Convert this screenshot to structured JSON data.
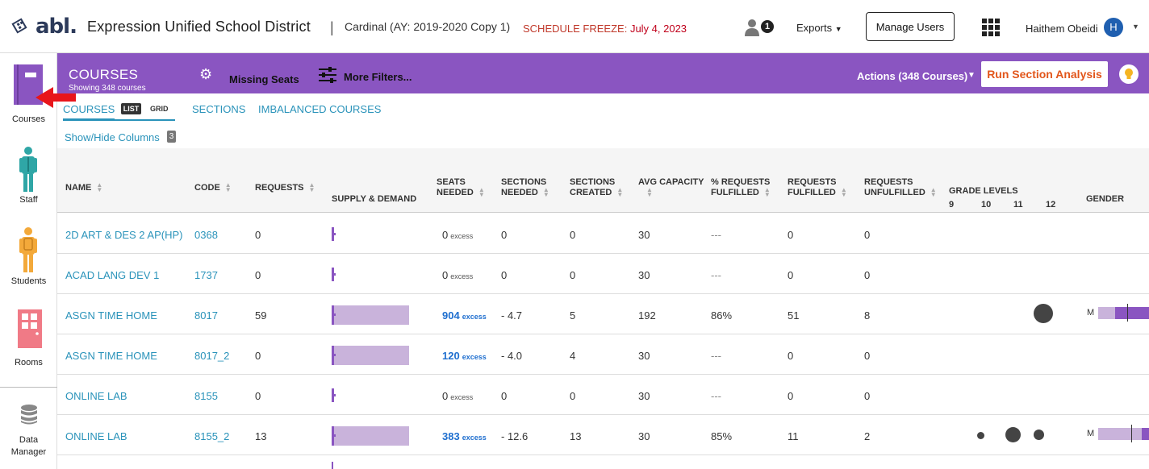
{
  "app": {
    "logo_text": "abl.",
    "district": "Expression Unified School District",
    "separator": "|",
    "schedule": "Cardinal (AY: 2019-2020 Copy 1)",
    "freeze_label": "SCHEDULE FREEZE:",
    "freeze_date": "July 4, 2023",
    "notif_count": "1",
    "exports_label": "Exports",
    "manage_users_label": "Manage Users",
    "user_name": "Haithem Obeidi",
    "user_initial": "H"
  },
  "sidebar": {
    "items": [
      {
        "label": "Courses"
      },
      {
        "label": "Staff"
      },
      {
        "label": "Students"
      },
      {
        "label": "Rooms"
      },
      {
        "label": "Data"
      },
      {
        "label": "Manager"
      }
    ]
  },
  "header": {
    "title": "COURSES",
    "showing": "Showing 348 courses",
    "missing_seats": "Missing Seats",
    "more_filters": "More Filters...",
    "actions": "Actions (348 Courses)",
    "run_button": "Run Section Analysis"
  },
  "tabs": {
    "courses": "COURSES",
    "list": "LIST",
    "grid": "GRID",
    "sections": "SECTIONS",
    "imbalanced": "IMBALANCED COURSES"
  },
  "columns_toggle": {
    "label": "Show/Hide Columns",
    "count": "3"
  },
  "table": {
    "headers": {
      "name": "NAME",
      "code": "CODE",
      "requests": "REQUESTS",
      "supply": "SUPPLY & DEMAND",
      "seats1": "SEATS",
      "seats2": "NEEDED",
      "secneeded1": "SECTIONS",
      "secneeded2": "NEEDED",
      "seccreated1": "SECTIONS",
      "seccreated2": "CREATED",
      "avgcap": "AVG CAPACITY",
      "pct1": "% REQUESTS",
      "pct2": "FULFILLED",
      "ful1": "REQUESTS",
      "ful2": "FULFILLED",
      "unful1": "REQUESTS",
      "unful2": "UNFULFILLED",
      "grade": "GRADE LEVELS",
      "g9": "9",
      "g10": "10",
      "g11": "11",
      "g12": "12",
      "gender": "GENDER"
    },
    "excess_label": "excess",
    "rows": [
      {
        "name": "2D ART & DES 2 AP(HP)",
        "code": "0368",
        "requests": "0",
        "seats": "0",
        "sec_needed": "0",
        "sec_created": "0",
        "avg": "30",
        "pct": "---",
        "ful": "0",
        "unful": "0",
        "bar_fill": 0
      },
      {
        "name": "ACAD LANG DEV 1",
        "code": "1737",
        "requests": "0",
        "seats": "0",
        "sec_needed": "0",
        "sec_created": "0",
        "avg": "30",
        "pct": "---",
        "ful": "0",
        "unful": "0",
        "bar_fill": 0
      },
      {
        "name": "ASGN TIME HOME",
        "code": "8017",
        "requests": "59",
        "seats": "904",
        "sec_needed": "- 4.7",
        "sec_created": "5",
        "avg": "192",
        "pct": "86%",
        "ful": "51",
        "unful": "8",
        "bar_fill": 1,
        "gender_m": "M"
      },
      {
        "name": "ASGN TIME HOME",
        "code": "8017_2",
        "requests": "0",
        "seats": "120",
        "sec_needed": "- 4.0",
        "sec_created": "4",
        "avg": "30",
        "pct": "---",
        "ful": "0",
        "unful": "0",
        "bar_fill": 1
      },
      {
        "name": "ONLINE LAB",
        "code": "8155",
        "requests": "0",
        "seats": "0",
        "sec_needed": "0",
        "sec_created": "0",
        "avg": "30",
        "pct": "---",
        "ful": "0",
        "unful": "0",
        "bar_fill": 0
      },
      {
        "name": "ONLINE LAB",
        "code": "8155_2",
        "requests": "13",
        "seats": "383",
        "sec_needed": "- 12.6",
        "sec_created": "13",
        "avg": "30",
        "pct": "85%",
        "ful": "11",
        "unful": "2",
        "bar_fill": 1,
        "gender_m": "M"
      }
    ]
  },
  "colors": {
    "purple": "#8a55c1",
    "accent_orange": "#e2561b",
    "link": "#2a93ba",
    "freeze_red": "#c0001b"
  }
}
